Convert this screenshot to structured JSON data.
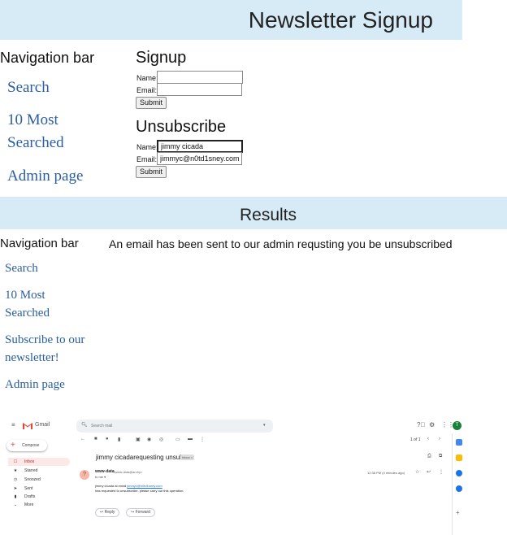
{
  "signup_page": {
    "title": "Newsletter Signup",
    "nav_heading": "Navigation bar",
    "nav_links": [
      "Search",
      "10 Most",
      "Searched",
      "Admin page"
    ],
    "signup": {
      "heading": "Signup",
      "name_label": "Name:",
      "email_label": "Email:",
      "name_value": "",
      "email_value": "",
      "submit_label": "Submit"
    },
    "unsubscribe": {
      "heading": "Unsubscribe",
      "name_label": "Name:",
      "email_label": "Email:",
      "name_value": "jimmy cicada",
      "email_value": "jimmyc@n0td1sney.com",
      "submit_label": "Submit"
    }
  },
  "results_page": {
    "title": "Results",
    "nav_heading": "Navigation bar",
    "message": "An email has been sent to our admin requsting you be unsubscribed",
    "nav_links": [
      "Search",
      "10 Most",
      "Searched",
      "Subscribe to our",
      "newsletter!",
      "Admin page"
    ]
  },
  "gmail": {
    "app_name": "Gmail",
    "search_placeholder": "Search mail",
    "compose_label": "Compose",
    "sidebar": [
      "Inbox",
      "Starred",
      "Snoozed",
      "Sent",
      "Drafts",
      "More"
    ],
    "pager": "1 of 1",
    "avatar_letter": "T",
    "subject": "jimmy cicadarequesting unsub",
    "inbox_badge": "Inbox ×",
    "sender_name": "www-data",
    "sender_email": "<www-data@archy>",
    "to_line": "to me ▾",
    "timestamp": "12:38 PM (0 minutes ago)",
    "body_prefix": "jimmy cicada at email",
    "body_link": "jimmyc@n0td1sney.com",
    "body_line2": "has requested to unsubscribe. please carry out this operation.",
    "reply_label": "Reply",
    "forward_label": "Forward",
    "colors": {
      "brand_red": "#ea4335",
      "inbox_active_bg": "#fce8e6",
      "avatar_bg": "#188038"
    }
  }
}
